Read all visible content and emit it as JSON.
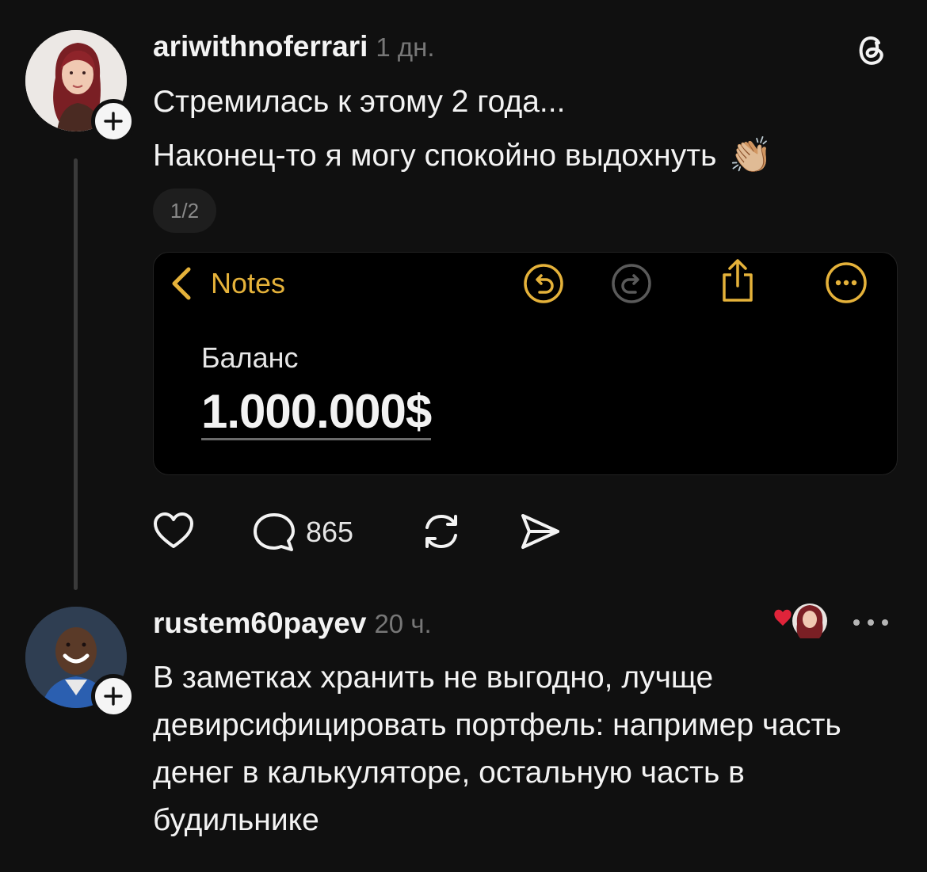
{
  "post": {
    "username": "ariwithnoferrari",
    "time": "1 дн.",
    "line1": "Стремилась к этому 2 года...",
    "line2": "Наконец-то я могу спокойно выдохнуть",
    "emoji": "👏🏼",
    "pager": "1/2",
    "image": {
      "back_label": "Notes",
      "balance_label": "Баланс",
      "balance_value": "1.000.000$"
    },
    "actions": {
      "comments_count": "865"
    }
  },
  "comment": {
    "username": "rustem60payev",
    "time": "20 ч.",
    "text": "В заметках хранить не выгодно, лучще девирсифицировать портфель: например часть денег в калькуляторе, остальную часть в будильнике"
  },
  "icons": {
    "app": "threads-icon",
    "accent": "#e5b23a",
    "like_heart": "#e0243a"
  }
}
